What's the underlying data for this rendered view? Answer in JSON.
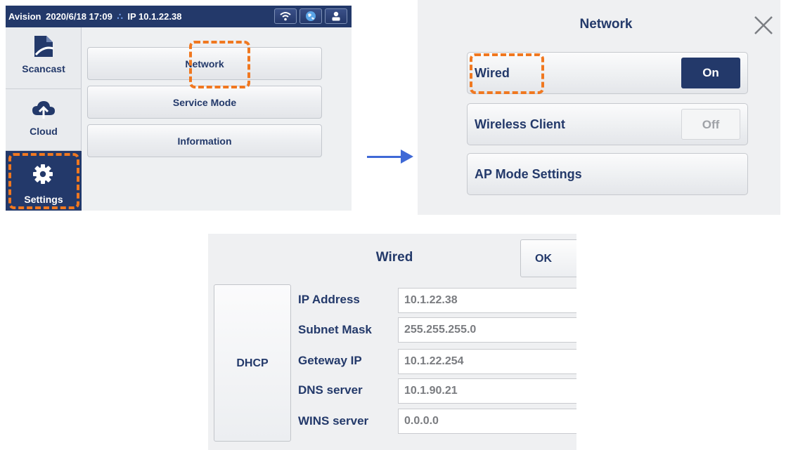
{
  "colors": {
    "navy": "#23396a",
    "highlight": "#f07820",
    "arrow": "#3f69d6"
  },
  "main_screen": {
    "status_bar": {
      "brand": "Avision",
      "datetime": "2020/6/18 17:09",
      "ip": "IP 10.1.22.38",
      "icons": [
        "wifi-icon",
        "globe-icon",
        "user-icon"
      ]
    },
    "sidebar": {
      "items": [
        {
          "label": "Scancast",
          "icon": "scancast-icon"
        },
        {
          "label": "Cloud",
          "icon": "cloud-upload-icon"
        },
        {
          "label": "Settings",
          "icon": "gear-icon",
          "selected": true
        }
      ]
    },
    "menu": [
      "Network",
      "Service Mode",
      "Information"
    ]
  },
  "network_screen": {
    "title": "Network",
    "rows": [
      {
        "label": "Wired",
        "toggle": "On"
      },
      {
        "label": "Wireless Client",
        "toggle": "Off"
      },
      {
        "label": "AP Mode Settings"
      }
    ]
  },
  "wired_screen": {
    "title": "Wired",
    "ok_label": "OK",
    "dhcp_label": "DHCP",
    "fields": [
      {
        "label": "IP Address",
        "value": "10.1.22.38"
      },
      {
        "label": "Subnet Mask",
        "value": "255.255.255.0"
      },
      {
        "label": "Geteway IP",
        "value": "10.1.22.254"
      },
      {
        "label": "DNS server",
        "value": "10.1.90.21"
      },
      {
        "label": "WINS server",
        "value": "0.0.0.0"
      }
    ]
  }
}
